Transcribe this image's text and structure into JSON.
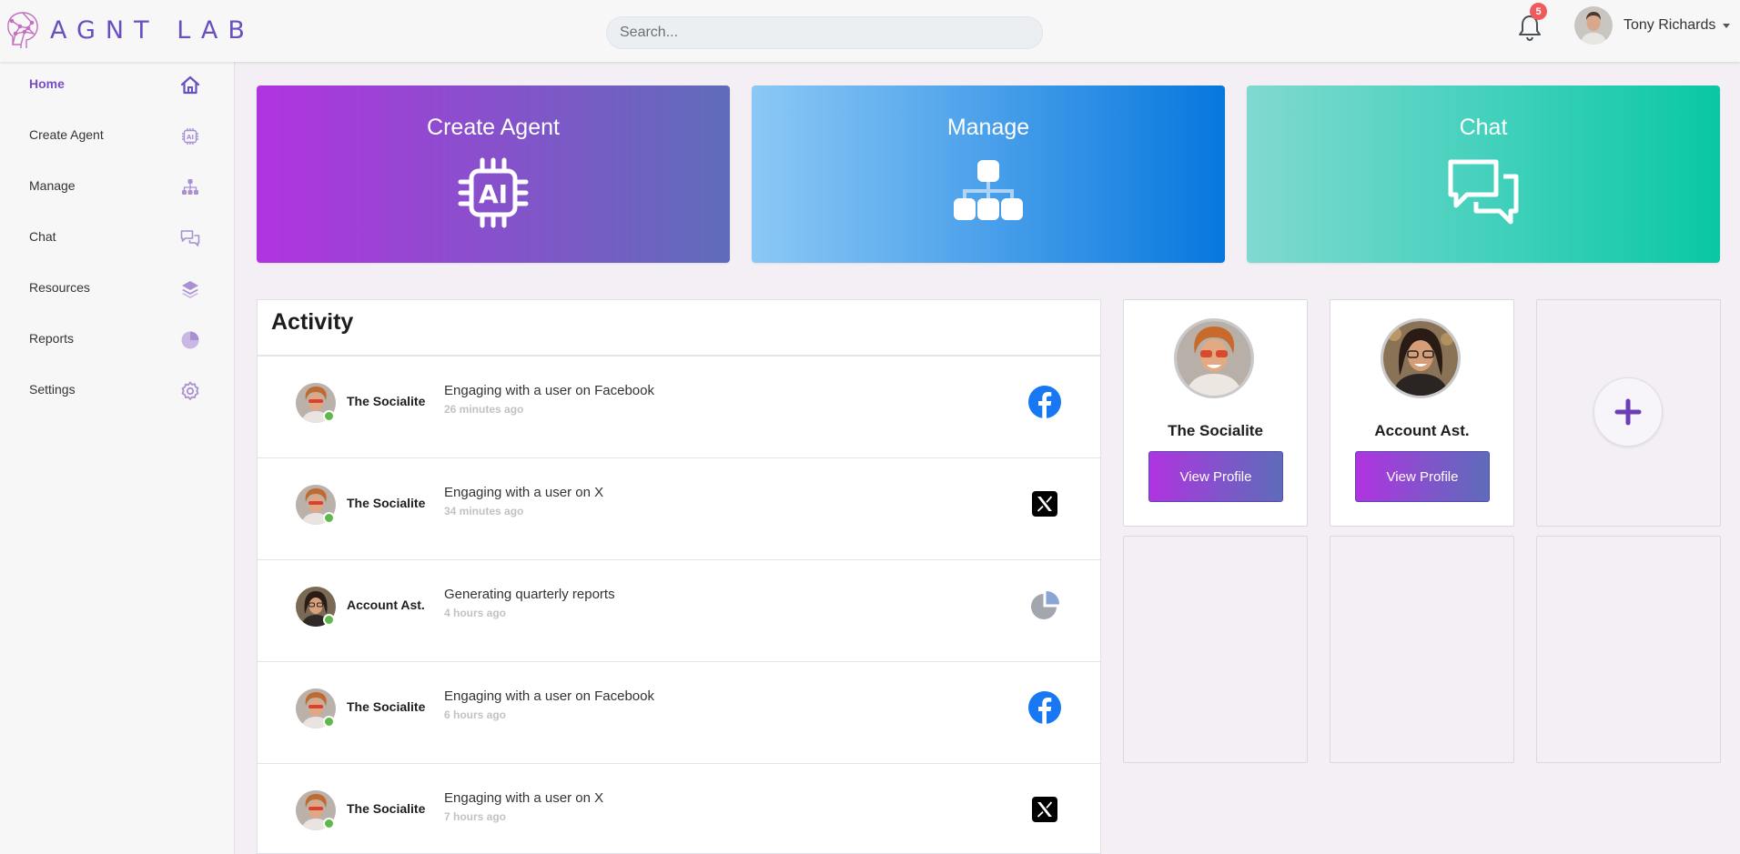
{
  "brand": {
    "name": "AGNT LAB",
    "accent": "#6a4fc1"
  },
  "header": {
    "search_placeholder": "Search...",
    "notifications_count": "5",
    "user_name": "Tony Richards"
  },
  "sidebar": {
    "items": [
      {
        "label": "Home",
        "icon": "home-icon",
        "active": true
      },
      {
        "label": "Create Agent",
        "icon": "ai-chip-icon"
      },
      {
        "label": "Manage",
        "icon": "hierarchy-icon"
      },
      {
        "label": "Chat",
        "icon": "chat-icon"
      },
      {
        "label": "Resources",
        "icon": "layers-icon"
      },
      {
        "label": "Reports",
        "icon": "pie-chart-icon"
      },
      {
        "label": "Settings",
        "icon": "gear-icon"
      }
    ]
  },
  "cards": [
    {
      "title": "Create Agent",
      "icon": "ai-chip-icon"
    },
    {
      "title": "Manage",
      "icon": "hierarchy-icon"
    },
    {
      "title": "Chat",
      "icon": "chat-icon"
    }
  ],
  "activity": {
    "title": "Activity",
    "rows": [
      {
        "agent": "The Socialite",
        "description": "Engaging with a user on Facebook",
        "time": "26 minutes ago",
        "platform": "facebook-icon"
      },
      {
        "agent": "The Socialite",
        "description": "Engaging with a user on X",
        "time": "34 minutes ago",
        "platform": "x-icon"
      },
      {
        "agent": "Account Ast.",
        "description": "Generating quarterly reports",
        "time": "4 hours ago",
        "platform": "pie-chart-icon"
      },
      {
        "agent": "The Socialite",
        "description": "Engaging with a user on Facebook",
        "time": "6 hours ago",
        "platform": "facebook-icon"
      },
      {
        "agent": "The Socialite",
        "description": "Engaging with a user on X",
        "time": "7 hours ago",
        "platform": "x-icon"
      }
    ]
  },
  "agents": [
    {
      "name": "The Socialite",
      "button": "View Profile"
    },
    {
      "name": "Account Ast.",
      "button": "View Profile"
    }
  ],
  "add_agent_icon": "plus-icon",
  "colors": {
    "facebook": "#1877f2",
    "online": "#5db94b",
    "badge": "#ef5a5f"
  }
}
